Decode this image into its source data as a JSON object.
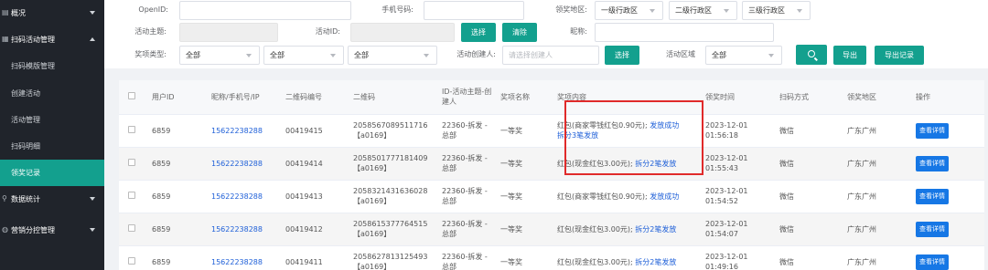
{
  "sidebar": {
    "items": [
      {
        "label": "概况",
        "icon": "chart-icon",
        "arrow": "down"
      },
      {
        "label": "扫码活动管理",
        "icon": "qrcode-icon",
        "arrow": "up"
      },
      {
        "label": "扫码模版管理"
      },
      {
        "label": "创建活动"
      },
      {
        "label": "活动管理"
      },
      {
        "label": "扫码明细"
      },
      {
        "label": "领奖记录",
        "active": true
      },
      {
        "label": "数据统计",
        "icon": "stats-icon",
        "arrow": "down"
      },
      {
        "label": "营销分控管理",
        "icon": "control-icon",
        "arrow": "down"
      }
    ]
  },
  "filters": {
    "openid_label": "OpenID:",
    "phone_label": "手机号码:",
    "region_label": "领奖地区:",
    "region1": "一级行政区",
    "region2": "二级行政区",
    "region3": "三级行政区",
    "theme_label": "活动主题:",
    "activity_id_label": "活动ID:",
    "select_button": "选择",
    "clear_button": "清除",
    "nickname_label": "昵称:",
    "prize_type_label": "奖项类型:",
    "prize_type1": "全部",
    "prize_type2": "全部",
    "prize_type3": "全部",
    "creator_label": "活动创建人:",
    "creator_placeholder": "请选择创建人",
    "select_button2": "选择",
    "area_label": "活动区域",
    "area_value": "全部",
    "export_button": "导出",
    "export_records_button": "导出记录"
  },
  "table": {
    "headers": [
      "用户ID",
      "昵称/手机号/IP",
      "二维码编号",
      "二维码",
      "ID-活动主题-创建人",
      "奖项名称",
      "奖项内容",
      "领奖时间",
      "扫码方式",
      "领奖地区",
      "操作"
    ],
    "rows": [
      {
        "user_id": "6859",
        "phone": "15622238288",
        "qr_no": "00419415",
        "qr_line1": "2058567089511716",
        "qr_line2": "【a0169】",
        "act_line1": "22360-拆发 -",
        "act_line2": "总部",
        "prize": "一等奖",
        "content_plain": "红包(商家零钱红包0.90元);",
        "content_link": "发放成功",
        "content_line2": "拆分3笔发放",
        "time_line1": "2023-12-01",
        "time_line2": "01:56:18",
        "scan": "微信",
        "region": "广东广州",
        "action": "查看详情"
      },
      {
        "user_id": "6859",
        "phone": "15622238288",
        "qr_no": "00419414",
        "qr_line1": "2058501777181409",
        "qr_line2": "【a0169】",
        "act_line1": "22360-拆发 -",
        "act_line2": "总部",
        "prize": "一等奖",
        "content_plain": "红包(现金红包3.00元);",
        "content_link": "拆分2笔发放",
        "content_line2": "",
        "time_line1": "2023-12-01",
        "time_line2": "01:55:43",
        "scan": "微信",
        "region": "广东广州",
        "action": "查看详情"
      },
      {
        "user_id": "6859",
        "phone": "15622238288",
        "qr_no": "00419413",
        "qr_line1": "2058321431636028",
        "qr_line2": "【a0169】",
        "act_line1": "22360-拆发 -",
        "act_line2": "总部",
        "prize": "一等奖",
        "content_plain": "红包(商家零钱红包0.90元);",
        "content_link": "发放成功",
        "content_line2": "",
        "time_line1": "2023-12-01",
        "time_line2": "01:54:52",
        "scan": "微信",
        "region": "广东广州",
        "action": "查看详情"
      },
      {
        "user_id": "6859",
        "phone": "15622238288",
        "qr_no": "00419412",
        "qr_line1": "2058615377764515",
        "qr_line2": "【a0169】",
        "act_line1": "22360-拆发 -",
        "act_line2": "总部",
        "prize": "一等奖",
        "content_plain": "红包(现金红包3.00元);",
        "content_link": "拆分2笔发放",
        "content_line2": "",
        "time_line1": "2023-12-01",
        "time_line2": "01:54:07",
        "scan": "微信",
        "region": "广东广州",
        "action": "查看详情"
      },
      {
        "user_id": "6859",
        "phone": "15622238288",
        "qr_no": "00419411",
        "qr_line1": "2058627813125493",
        "qr_line2": "【a0169】",
        "act_line1": "22360-拆发 -",
        "act_line2": "总部",
        "prize": "一等奖",
        "content_plain": "红包(现金红包3.00元);",
        "content_link": "拆分2笔发放",
        "content_line2": "",
        "time_line1": "2023-12-01",
        "time_line2": "01:49:16",
        "scan": "微信",
        "region": "广东广州",
        "action": "查看详情"
      }
    ]
  },
  "colors": {
    "accent": "#13a08e",
    "sidebar": "#20242b",
    "link": "#1e5fd8",
    "highlight_box": "#e02a2a",
    "detail_button": "#1677e5"
  }
}
